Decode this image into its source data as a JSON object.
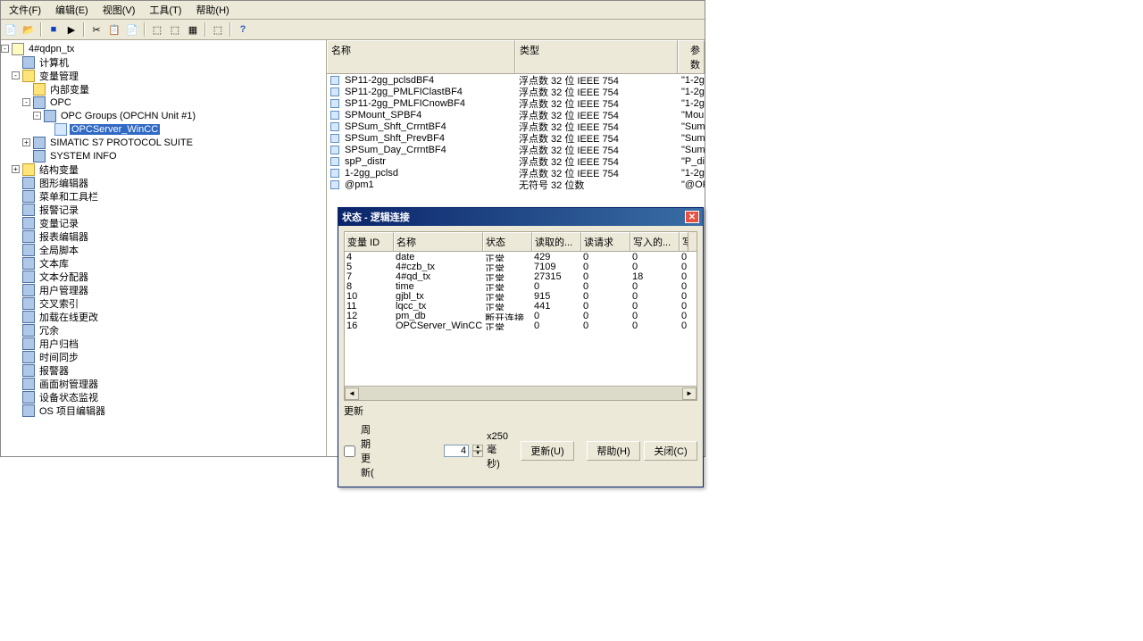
{
  "menubar": [
    "文件(F)",
    "编辑(E)",
    "视图(V)",
    "工具(T)",
    "帮助(H)"
  ],
  "tree": {
    "root": "4#qdpn_tx",
    "items": [
      {
        "indent": 1,
        "icon": "node",
        "label": "计算机",
        "toggle": ""
      },
      {
        "indent": 1,
        "icon": "folder",
        "label": "变量管理",
        "toggle": "-"
      },
      {
        "indent": 2,
        "icon": "folder",
        "label": "内部变量",
        "toggle": ""
      },
      {
        "indent": 2,
        "icon": "node",
        "label": "OPC",
        "toggle": "-"
      },
      {
        "indent": 3,
        "icon": "node",
        "label": "OPC Groups (OPCHN Unit #1)",
        "toggle": "-"
      },
      {
        "indent": 4,
        "icon": "leaf",
        "label": "OPCServer_WinCC",
        "toggle": "",
        "selected": true
      },
      {
        "indent": 2,
        "icon": "node",
        "label": "SIMATIC S7 PROTOCOL SUITE",
        "toggle": "+"
      },
      {
        "indent": 2,
        "icon": "node",
        "label": "SYSTEM INFO",
        "toggle": ""
      },
      {
        "indent": 1,
        "icon": "folder",
        "label": "结构变量",
        "toggle": "+"
      },
      {
        "indent": 1,
        "icon": "node",
        "label": "图形编辑器",
        "toggle": ""
      },
      {
        "indent": 1,
        "icon": "node",
        "label": "菜单和工具栏",
        "toggle": ""
      },
      {
        "indent": 1,
        "icon": "node",
        "label": "报警记录",
        "toggle": ""
      },
      {
        "indent": 1,
        "icon": "node",
        "label": "变量记录",
        "toggle": ""
      },
      {
        "indent": 1,
        "icon": "node",
        "label": "报表编辑器",
        "toggle": ""
      },
      {
        "indent": 1,
        "icon": "node",
        "label": "全局脚本",
        "toggle": ""
      },
      {
        "indent": 1,
        "icon": "node",
        "label": "文本库",
        "toggle": ""
      },
      {
        "indent": 1,
        "icon": "node",
        "label": "文本分配器",
        "toggle": ""
      },
      {
        "indent": 1,
        "icon": "node",
        "label": "用户管理器",
        "toggle": ""
      },
      {
        "indent": 1,
        "icon": "node",
        "label": "交叉索引",
        "toggle": ""
      },
      {
        "indent": 1,
        "icon": "node",
        "label": "加载在线更改",
        "toggle": ""
      },
      {
        "indent": 1,
        "icon": "node",
        "label": "冗余",
        "toggle": ""
      },
      {
        "indent": 1,
        "icon": "node",
        "label": "用户归档",
        "toggle": ""
      },
      {
        "indent": 1,
        "icon": "node",
        "label": "时间同步",
        "toggle": ""
      },
      {
        "indent": 1,
        "icon": "node",
        "label": "报警器",
        "toggle": ""
      },
      {
        "indent": 1,
        "icon": "node",
        "label": "画面树管理器",
        "toggle": ""
      },
      {
        "indent": 1,
        "icon": "node",
        "label": "设备状态监视",
        "toggle": ""
      },
      {
        "indent": 1,
        "icon": "node",
        "label": "OS 项目编辑器",
        "toggle": ""
      }
    ]
  },
  "list": {
    "columns": [
      "名称",
      "类型",
      "参数"
    ],
    "rows": [
      {
        "name": "SP11-2gg_pclsdBF4",
        "type": "浮点数 32 位 IEEE 754",
        "param": "\"1-2g"
      },
      {
        "name": "SP11-2gg_PMLFIClastBF4",
        "type": "浮点数 32 位 IEEE 754",
        "param": "\"1-2g"
      },
      {
        "name": "SP11-2gg_PMLFICnowBF4",
        "type": "浮点数 32 位 IEEE 754",
        "param": "\"1-2g"
      },
      {
        "name": "SPMount_SPBF4",
        "type": "浮点数 32 位 IEEE 754",
        "param": "\"Moun"
      },
      {
        "name": "SPSum_Shft_CrrntBF4",
        "type": "浮点数 32 位 IEEE 754",
        "param": "\"Sum_"
      },
      {
        "name": "SPSum_Shft_PrevBF4",
        "type": "浮点数 32 位 IEEE 754",
        "param": "\"Sum_"
      },
      {
        "name": "SPSum_Day_CrrntBF4",
        "type": "浮点数 32 位 IEEE 754",
        "param": "\"Sum_"
      },
      {
        "name": "spP_distr",
        "type": "浮点数 32 位 IEEE 754",
        "param": "\"P_di"
      },
      {
        "name": "1-2gg_pclsd",
        "type": "浮点数 32 位 IEEE 754",
        "param": "\"1-2g"
      },
      {
        "name": "@pm1",
        "type": "无符号 32 位数",
        "param": "\"@OPC"
      }
    ]
  },
  "dialog": {
    "title": "状态 - 逻辑连接",
    "columns": [
      "变量 ID",
      "名称",
      "状态",
      "读取的...",
      "读请求",
      "写入的...",
      "写"
    ],
    "rows": [
      {
        "id": "4",
        "name": "date",
        "status": "正常",
        "read": "429",
        "req": "0",
        "write": "0",
        "w": "0"
      },
      {
        "id": "5",
        "name": "4#czb_tx",
        "status": "正常",
        "read": "7109",
        "req": "0",
        "write": "0",
        "w": "0"
      },
      {
        "id": "7",
        "name": "4#qd_tx",
        "status": "正常",
        "read": "27315",
        "req": "0",
        "write": "18",
        "w": "0"
      },
      {
        "id": "8",
        "name": "time",
        "status": "正常",
        "read": "0",
        "req": "0",
        "write": "0",
        "w": "0"
      },
      {
        "id": "10",
        "name": "gjbl_tx",
        "status": "正常",
        "read": "915",
        "req": "0",
        "write": "0",
        "w": "0"
      },
      {
        "id": "11",
        "name": "lqcc_tx",
        "status": "正常",
        "read": "441",
        "req": "0",
        "write": "0",
        "w": "0"
      },
      {
        "id": "12",
        "name": "pm_db",
        "status": "断开连接",
        "read": "0",
        "req": "0",
        "write": "0",
        "w": "0"
      },
      {
        "id": "16",
        "name": "OPCServer_WinCC",
        "status": "正常",
        "read": "0",
        "req": "0",
        "write": "0",
        "w": "0"
      }
    ],
    "update_label": "更新",
    "cyclic_label": "周期更新(",
    "cyclic_value": "4",
    "cyclic_suffix": "x250 毫秒)",
    "btn_update": "更新(U)",
    "btn_help": "帮助(H)",
    "btn_close": "关闭(C)"
  }
}
